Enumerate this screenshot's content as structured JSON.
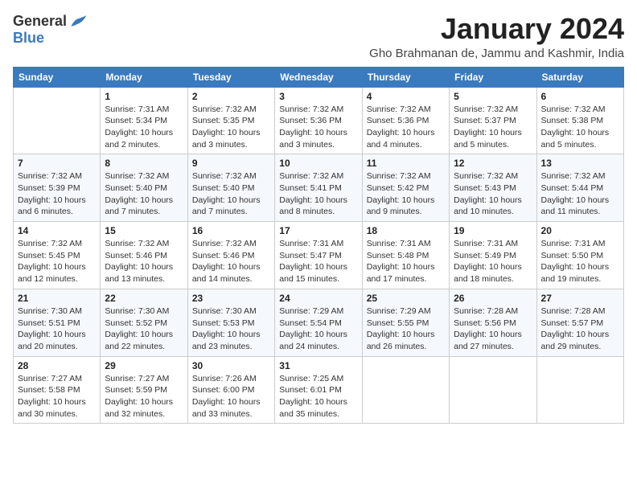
{
  "header": {
    "logo_general": "General",
    "logo_blue": "Blue",
    "title": "January 2024",
    "subtitle": "Gho Brahmanan de, Jammu and Kashmir, India"
  },
  "days_of_week": [
    "Sunday",
    "Monday",
    "Tuesday",
    "Wednesday",
    "Thursday",
    "Friday",
    "Saturday"
  ],
  "weeks": [
    [
      {
        "num": "",
        "detail": ""
      },
      {
        "num": "1",
        "detail": "Sunrise: 7:31 AM\nSunset: 5:34 PM\nDaylight: 10 hours\nand 2 minutes."
      },
      {
        "num": "2",
        "detail": "Sunrise: 7:32 AM\nSunset: 5:35 PM\nDaylight: 10 hours\nand 3 minutes."
      },
      {
        "num": "3",
        "detail": "Sunrise: 7:32 AM\nSunset: 5:36 PM\nDaylight: 10 hours\nand 3 minutes."
      },
      {
        "num": "4",
        "detail": "Sunrise: 7:32 AM\nSunset: 5:36 PM\nDaylight: 10 hours\nand 4 minutes."
      },
      {
        "num": "5",
        "detail": "Sunrise: 7:32 AM\nSunset: 5:37 PM\nDaylight: 10 hours\nand 5 minutes."
      },
      {
        "num": "6",
        "detail": "Sunrise: 7:32 AM\nSunset: 5:38 PM\nDaylight: 10 hours\nand 5 minutes."
      }
    ],
    [
      {
        "num": "7",
        "detail": "Sunrise: 7:32 AM\nSunset: 5:39 PM\nDaylight: 10 hours\nand 6 minutes."
      },
      {
        "num": "8",
        "detail": "Sunrise: 7:32 AM\nSunset: 5:40 PM\nDaylight: 10 hours\nand 7 minutes."
      },
      {
        "num": "9",
        "detail": "Sunrise: 7:32 AM\nSunset: 5:40 PM\nDaylight: 10 hours\nand 7 minutes."
      },
      {
        "num": "10",
        "detail": "Sunrise: 7:32 AM\nSunset: 5:41 PM\nDaylight: 10 hours\nand 8 minutes."
      },
      {
        "num": "11",
        "detail": "Sunrise: 7:32 AM\nSunset: 5:42 PM\nDaylight: 10 hours\nand 9 minutes."
      },
      {
        "num": "12",
        "detail": "Sunrise: 7:32 AM\nSunset: 5:43 PM\nDaylight: 10 hours\nand 10 minutes."
      },
      {
        "num": "13",
        "detail": "Sunrise: 7:32 AM\nSunset: 5:44 PM\nDaylight: 10 hours\nand 11 minutes."
      }
    ],
    [
      {
        "num": "14",
        "detail": "Sunrise: 7:32 AM\nSunset: 5:45 PM\nDaylight: 10 hours\nand 12 minutes."
      },
      {
        "num": "15",
        "detail": "Sunrise: 7:32 AM\nSunset: 5:46 PM\nDaylight: 10 hours\nand 13 minutes."
      },
      {
        "num": "16",
        "detail": "Sunrise: 7:32 AM\nSunset: 5:46 PM\nDaylight: 10 hours\nand 14 minutes."
      },
      {
        "num": "17",
        "detail": "Sunrise: 7:31 AM\nSunset: 5:47 PM\nDaylight: 10 hours\nand 15 minutes."
      },
      {
        "num": "18",
        "detail": "Sunrise: 7:31 AM\nSunset: 5:48 PM\nDaylight: 10 hours\nand 17 minutes."
      },
      {
        "num": "19",
        "detail": "Sunrise: 7:31 AM\nSunset: 5:49 PM\nDaylight: 10 hours\nand 18 minutes."
      },
      {
        "num": "20",
        "detail": "Sunrise: 7:31 AM\nSunset: 5:50 PM\nDaylight: 10 hours\nand 19 minutes."
      }
    ],
    [
      {
        "num": "21",
        "detail": "Sunrise: 7:30 AM\nSunset: 5:51 PM\nDaylight: 10 hours\nand 20 minutes."
      },
      {
        "num": "22",
        "detail": "Sunrise: 7:30 AM\nSunset: 5:52 PM\nDaylight: 10 hours\nand 22 minutes."
      },
      {
        "num": "23",
        "detail": "Sunrise: 7:30 AM\nSunset: 5:53 PM\nDaylight: 10 hours\nand 23 minutes."
      },
      {
        "num": "24",
        "detail": "Sunrise: 7:29 AM\nSunset: 5:54 PM\nDaylight: 10 hours\nand 24 minutes."
      },
      {
        "num": "25",
        "detail": "Sunrise: 7:29 AM\nSunset: 5:55 PM\nDaylight: 10 hours\nand 26 minutes."
      },
      {
        "num": "26",
        "detail": "Sunrise: 7:28 AM\nSunset: 5:56 PM\nDaylight: 10 hours\nand 27 minutes."
      },
      {
        "num": "27",
        "detail": "Sunrise: 7:28 AM\nSunset: 5:57 PM\nDaylight: 10 hours\nand 29 minutes."
      }
    ],
    [
      {
        "num": "28",
        "detail": "Sunrise: 7:27 AM\nSunset: 5:58 PM\nDaylight: 10 hours\nand 30 minutes."
      },
      {
        "num": "29",
        "detail": "Sunrise: 7:27 AM\nSunset: 5:59 PM\nDaylight: 10 hours\nand 32 minutes."
      },
      {
        "num": "30",
        "detail": "Sunrise: 7:26 AM\nSunset: 6:00 PM\nDaylight: 10 hours\nand 33 minutes."
      },
      {
        "num": "31",
        "detail": "Sunrise: 7:25 AM\nSunset: 6:01 PM\nDaylight: 10 hours\nand 35 minutes."
      },
      {
        "num": "",
        "detail": ""
      },
      {
        "num": "",
        "detail": ""
      },
      {
        "num": "",
        "detail": ""
      }
    ]
  ]
}
